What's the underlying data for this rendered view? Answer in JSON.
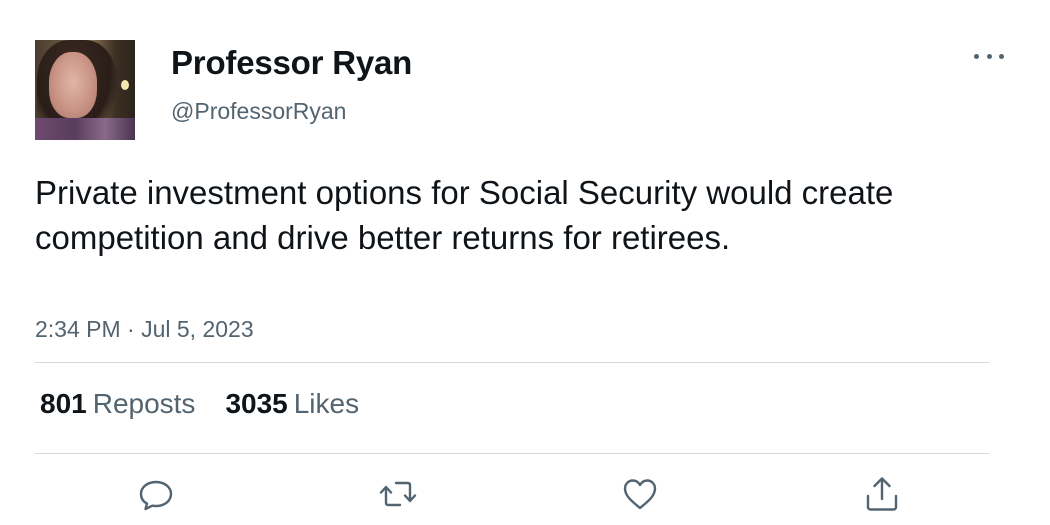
{
  "author": {
    "display_name": "Professor Ryan",
    "handle": "@ProfessorRyan"
  },
  "tweet": {
    "text": "Private investment options for Social Security would create competition and drive better returns for retirees.",
    "timestamp": "2:34 PM · Jul 5, 2023"
  },
  "stats": {
    "reposts_count": "801",
    "reposts_label": "Reposts",
    "likes_count": "3035",
    "likes_label": "Likes"
  },
  "icons": {
    "more": "more-horizontal-icon",
    "reply": "reply-icon",
    "repost": "repost-icon",
    "like": "heart-icon",
    "share": "share-icon"
  },
  "colors": {
    "text_primary": "#0f1419",
    "text_secondary": "#536471",
    "divider": "#cfd9de"
  }
}
